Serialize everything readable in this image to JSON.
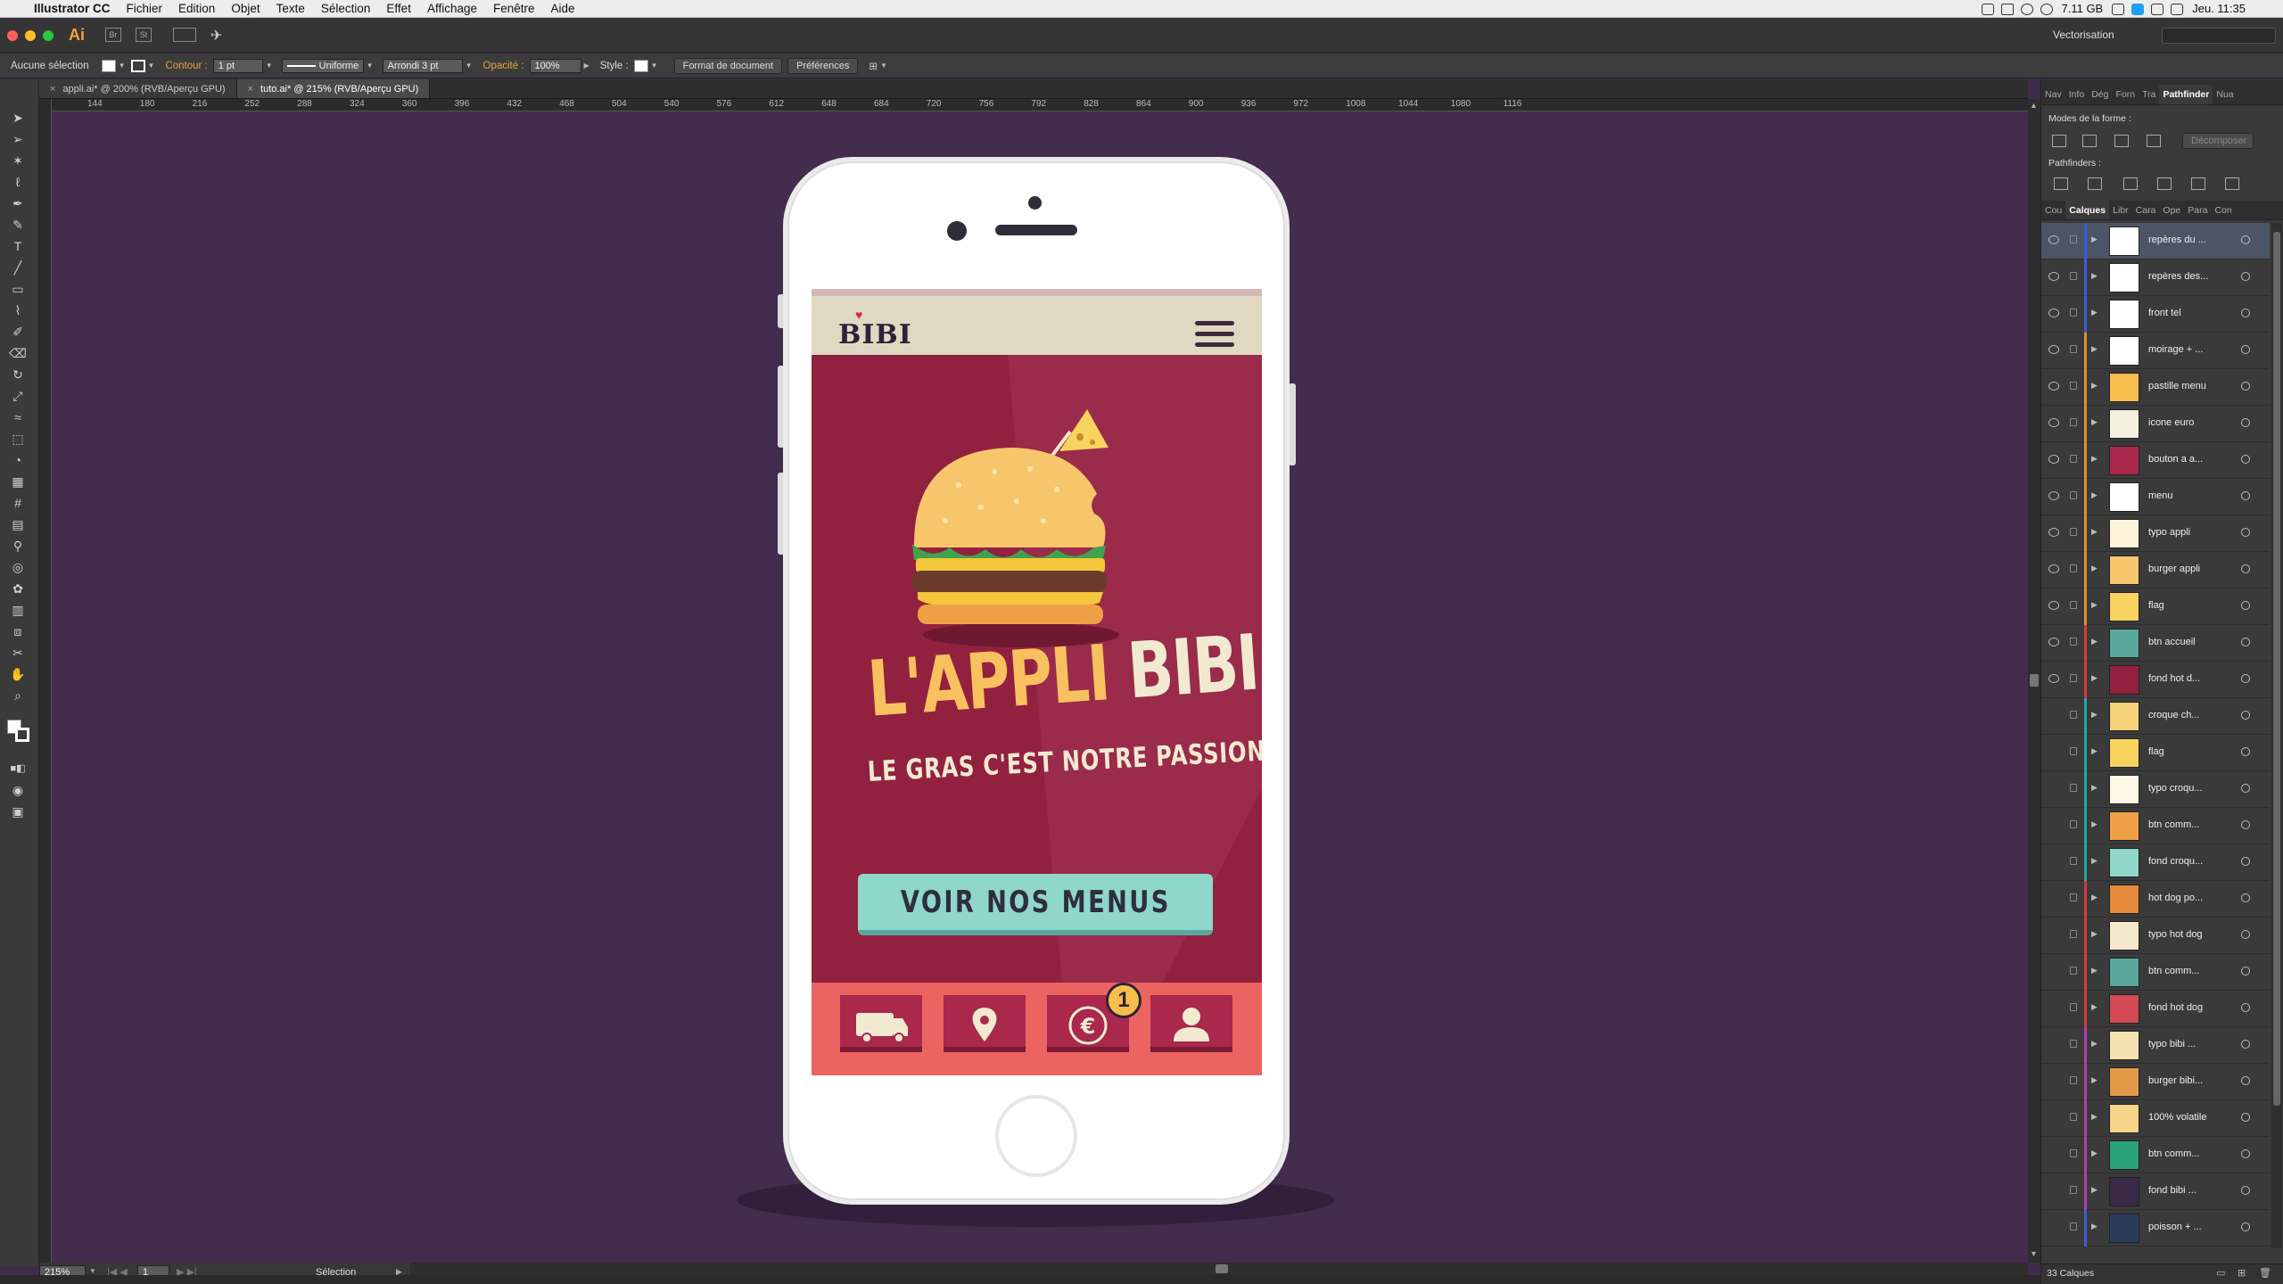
{
  "menubar": {
    "app": "Illustrator CC",
    "items": [
      "Fichier",
      "Edition",
      "Objet",
      "Texte",
      "Sélection",
      "Effet",
      "Affichage",
      "Fenêtre",
      "Aide"
    ],
    "memory": "7.11 GB",
    "clock": "Jeu. 11:35"
  },
  "appbar": {
    "ai_logo": "Ai",
    "workspace": "Vectorisation"
  },
  "controlbar": {
    "selection": "Aucune sélection",
    "contour_label": "Contour :",
    "stroke_weight": "1 pt",
    "stroke_profile": "Uniforme",
    "brush": "Arrondi 3 pt",
    "opacity_label": "Opacité :",
    "opacity_value": "100%",
    "style_label": "Style :",
    "doc_format_button": "Format de document",
    "prefs_button": "Préférences"
  },
  "tabs": [
    {
      "label": "appli.ai* @ 200% (RVB/Aperçu GPU)",
      "active": false
    },
    {
      "label": "tuto.ai* @ 215% (RVB/Aperçu GPU)",
      "active": true
    }
  ],
  "ruler": {
    "labels": [
      "144",
      "180",
      "216",
      "252",
      "288",
      "324",
      "360",
      "396",
      "432",
      "468",
      "504",
      "540",
      "576",
      "612",
      "648",
      "684",
      "720",
      "756",
      "792",
      "828",
      "864",
      "900",
      "936",
      "972",
      "1008",
      "1044",
      "1080",
      "1116"
    ]
  },
  "panel": {
    "top_tabs": [
      "Nav",
      "Info",
      "Dég",
      "Forn",
      "Tra",
      "Pathfinder",
      "Nua"
    ],
    "active_top_tab": "Pathfinder",
    "shape_modes_label": "Modes de la forme :",
    "expand_button": "Décomposer",
    "pathfinders_label": "Pathfinders :",
    "layer_tabs": [
      "Cou",
      "Calques",
      "Libr",
      "Cara",
      "Ope",
      "Para",
      "Con"
    ],
    "active_layer_tab": "Calques",
    "layers_count": "33 Calques",
    "layers": [
      {
        "name": "repères du ...",
        "color": "#3b5cd6",
        "thumb": "#ffffff",
        "eye": true,
        "selected": true
      },
      {
        "name": "repères des...",
        "color": "#3b5cd6",
        "thumb": "#ffffff",
        "eye": true
      },
      {
        "name": "front tel",
        "color": "#3b5cd6",
        "thumb": "#ffffff",
        "eye": true
      },
      {
        "name": "moirage + ...",
        "color": "#e28a2f",
        "thumb": "#ffffff",
        "eye": true
      },
      {
        "name": "pastille menu",
        "color": "#e28a2f",
        "thumb": "#f6bf4d",
        "eye": true
      },
      {
        "name": "icone euro",
        "color": "#e28a2f",
        "thumb": "#f3f0e0",
        "eye": true
      },
      {
        "name": "bouton a a...",
        "color": "#e28a2f",
        "thumb": "#a9284b",
        "eye": true
      },
      {
        "name": "menu",
        "color": "#e28a2f",
        "thumb": "#ffffff",
        "eye": true
      },
      {
        "name": "typo appli",
        "color": "#e28a2f",
        "thumb": "#fff5dc",
        "eye": true
      },
      {
        "name": "burger appli",
        "color": "#e28a2f",
        "thumb": "#f7c56b",
        "eye": true
      },
      {
        "name": "flag",
        "color": "#e28a2f",
        "thumb": "#f8d35f",
        "eye": true
      },
      {
        "name": "btn accueil",
        "color": "#d6393c",
        "thumb": "#5aa89c",
        "eye": true
      },
      {
        "name": "fond hot d...",
        "color": "#d6393c",
        "thumb": "#92213f",
        "eye": true
      },
      {
        "name": "croque ch...",
        "color": "#24a6a6",
        "thumb": "#f5d27a",
        "eye": false
      },
      {
        "name": "flag",
        "color": "#24a6a6",
        "thumb": "#f8d35f",
        "eye": false
      },
      {
        "name": "typo croqu...",
        "color": "#24a6a6",
        "thumb": "#fff8e6",
        "eye": false
      },
      {
        "name": "btn comm...",
        "color": "#24a6a6",
        "thumb": "#f0a044",
        "eye": false
      },
      {
        "name": "fond croqu...",
        "color": "#24a6a6",
        "thumb": "#8fd7c9",
        "eye": false
      },
      {
        "name": "hot dog po...",
        "color": "#d6393c",
        "thumb": "#e48a3a",
        "eye": false
      },
      {
        "name": "typo hot dog",
        "color": "#d6393c",
        "thumb": "#f4e9cc",
        "eye": false
      },
      {
        "name": "btn comm...",
        "color": "#d6393c",
        "thumb": "#5aa89c",
        "eye": false
      },
      {
        "name": "fond hot dog",
        "color": "#d6393c",
        "thumb": "#d34a55",
        "eye": false
      },
      {
        "name": "typo bibi ...",
        "color": "#b13db3",
        "thumb": "#f5e2b3",
        "eye": false
      },
      {
        "name": "burger bibi...",
        "color": "#b13db3",
        "thumb": "#e09a48",
        "eye": false
      },
      {
        "name": "100% volatile",
        "color": "#b13db3",
        "thumb": "#f6d58a",
        "eye": false
      },
      {
        "name": "btn comm...",
        "color": "#b13db3",
        "thumb": "#2aa37a",
        "eye": false
      },
      {
        "name": "fond bibi ...",
        "color": "#b13db3",
        "thumb": "#3a2a48",
        "eye": false
      },
      {
        "name": "poisson + ...",
        "color": "#3b5cd6",
        "thumb": "#2b3c5a",
        "eye": false
      }
    ]
  },
  "statusbar": {
    "zoom": "215%",
    "page": "1",
    "tool": "Sélection"
  },
  "artwork": {
    "logo": "BIBI",
    "title_part1": "L'APPLI",
    "title_part2": "BIBI",
    "tagline": "LE GRAS C'EST NOTRE PASSION",
    "cta": "VOIR NOS MENUS",
    "badge": "1",
    "colors": {
      "canvas": "#432c4d",
      "screen_bg": "#92213f",
      "header_bg": "#dfd9c1",
      "accent_yellow": "#f8c05e",
      "cream": "#f1ead1",
      "cta_teal": "#8fd7c9",
      "bottom_bar": "#eb6461"
    },
    "bottom_icons": [
      "truck-icon",
      "location-pin-icon",
      "euro-icon",
      "user-icon"
    ]
  }
}
